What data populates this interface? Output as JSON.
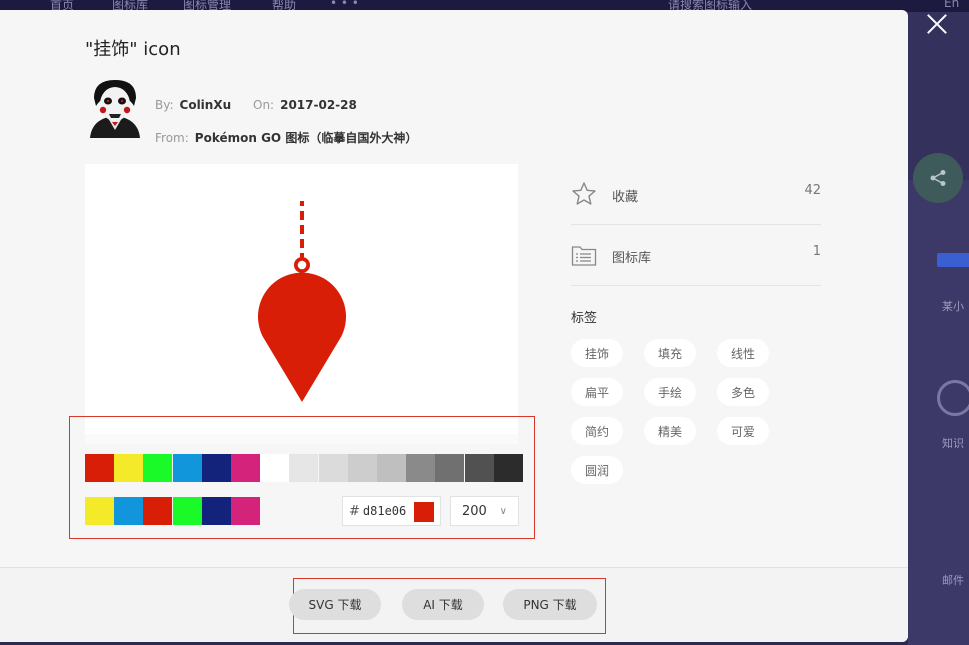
{
  "background": {
    "nav": [
      "首页",
      "图标库",
      "图标管理",
      "帮助",
      "• • •"
    ],
    "search_hint": "请搜索图标输入",
    "lang": "En",
    "side_labels": [
      "某小",
      "知识",
      "邮件"
    ]
  },
  "icon": {
    "title": "\"挂饰\" icon",
    "by_label": "By:",
    "author": "ColinXu",
    "on_label": "On:",
    "date": "2017-02-28",
    "from_label": "From:",
    "source": "Pokémon GO 图标（临摹自国外大神）",
    "fill_color": "#d81e06"
  },
  "palette": {
    "row1": [
      "#d81e06",
      "#f4ea2a",
      "#1afa29",
      "#1296db",
      "#13227a",
      "#d4237a",
      "#ffffff",
      "#e6e6e6",
      "#dbdbdb",
      "#cdcdcd",
      "#bfbfbf",
      "#8a8a8a",
      "#707070",
      "#515151",
      "#2c2c2c"
    ],
    "row2": [
      "#f4ea2a",
      "#1296db",
      "#d81e06",
      "#1afa29",
      "#13227a",
      "#d4237a"
    ],
    "hash": "#",
    "hex_value": "d81e06",
    "size": "200"
  },
  "stats": {
    "collect_label": "收藏",
    "collect_count": "42",
    "library_label": "图标库",
    "library_count": "1"
  },
  "tags": {
    "heading": "标签",
    "items": [
      "挂饰",
      "填充",
      "线性",
      "扁平",
      "手绘",
      "多色",
      "简约",
      "精美",
      "可爱",
      "圆润"
    ]
  },
  "downloads": {
    "svg": "SVG 下载",
    "ai": "AI 下载",
    "png": "PNG 下载"
  }
}
